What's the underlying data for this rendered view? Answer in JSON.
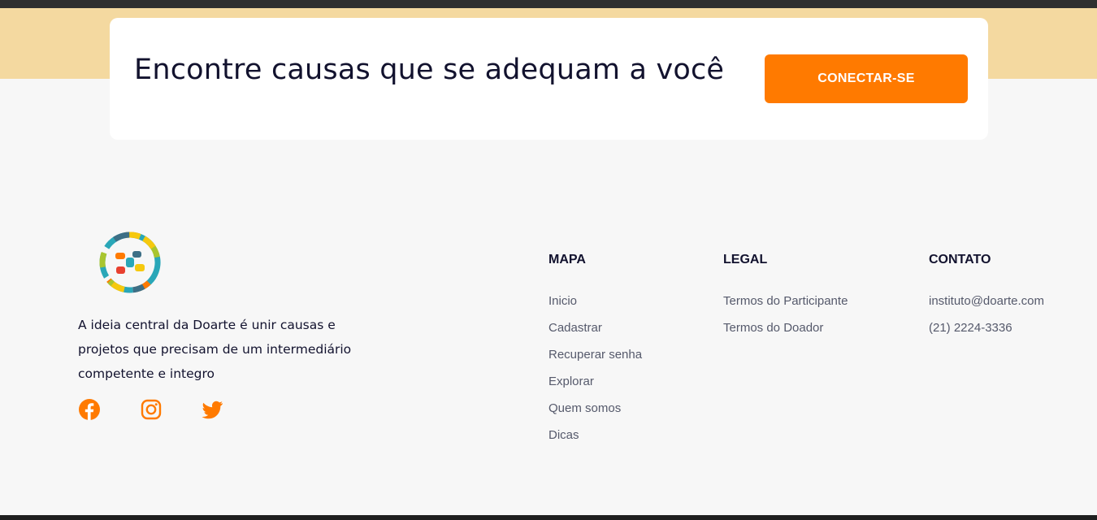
{
  "cta": {
    "title": "Encontre causas que se adequam a você",
    "button_label": "CONECTAR-SE"
  },
  "footer": {
    "about_text": "A ideia central da Doarte é unir causas e projetos que precisam de um intermediário competente e integro",
    "social": [
      {
        "name": "facebook-icon"
      },
      {
        "name": "instagram-icon"
      },
      {
        "name": "twitter-icon"
      }
    ],
    "columns": {
      "mapa": {
        "heading": "MAPA",
        "items": [
          "Inicio",
          "Cadastrar",
          "Recuperar senha",
          "Explorar",
          "Quem somos",
          "Dicas"
        ]
      },
      "legal": {
        "heading": "LEGAL",
        "items": [
          "Termos do Participante",
          "Termos do Doador"
        ]
      },
      "contato": {
        "heading": "CONTATO",
        "items": [
          "instituto@doarte.com",
          "(21) 2224-3336"
        ]
      }
    }
  },
  "colors": {
    "accent": "#ff7a00",
    "band": "#f4d9a0",
    "text_dark": "#12122e",
    "text_muted": "#55596b",
    "background": "#f7f7f7"
  }
}
